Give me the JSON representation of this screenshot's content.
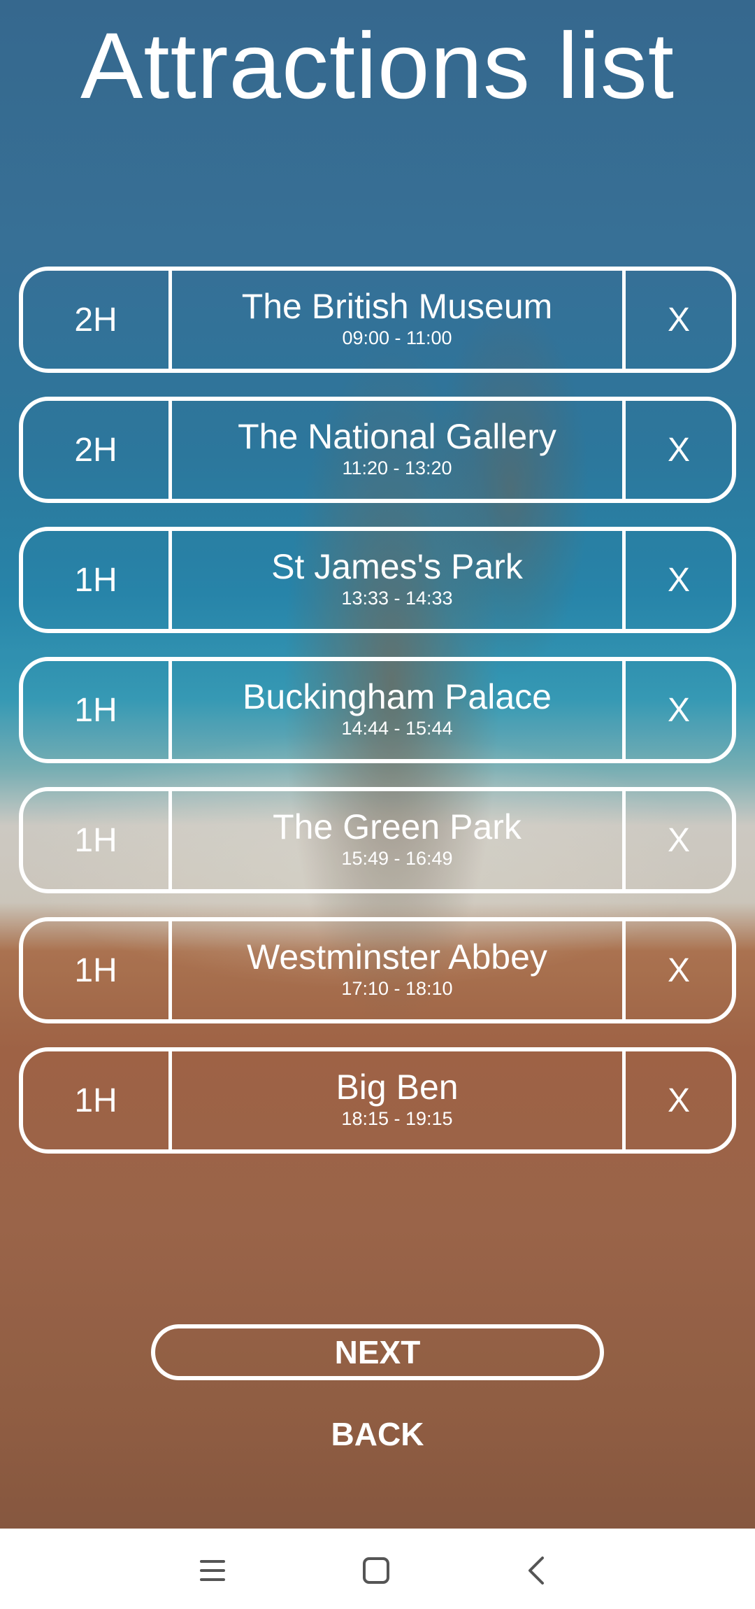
{
  "page": {
    "title": "Attractions list"
  },
  "attractions": [
    {
      "duration": "2H",
      "name": "The British Museum",
      "time": "09:00 - 11:00",
      "remove_label": "X"
    },
    {
      "duration": "2H",
      "name": "The National Gallery",
      "time": "11:20 - 13:20",
      "remove_label": "X"
    },
    {
      "duration": "1H",
      "name": "St James's Park",
      "time": "13:33 - 14:33",
      "remove_label": "X"
    },
    {
      "duration": "1H",
      "name": "Buckingham Palace",
      "time": "14:44 - 15:44",
      "remove_label": "X"
    },
    {
      "duration": "1H",
      "name": "The Green Park",
      "time": "15:49 - 16:49",
      "remove_label": "X"
    },
    {
      "duration": "1H",
      "name": "Westminster Abbey",
      "time": "17:10 - 18:10",
      "remove_label": "X"
    },
    {
      "duration": "1H",
      "name": "Big Ben",
      "time": "18:15 - 19:15",
      "remove_label": "X"
    }
  ],
  "actions": {
    "next_label": "NEXT",
    "back_label": "BACK"
  },
  "navigation_bar": {
    "icons": [
      "menu-icon",
      "home-icon",
      "back-icon"
    ]
  },
  "colors": {
    "foreground": "#ffffff",
    "nav_icon": "#555555",
    "nav_background": "#ffffff"
  }
}
